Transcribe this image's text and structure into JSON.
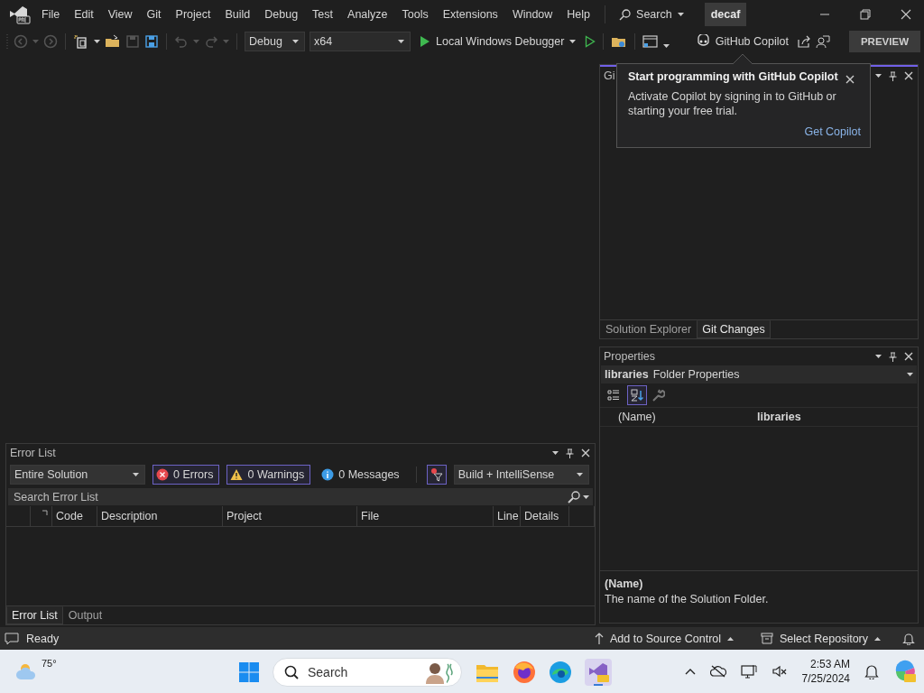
{
  "menu": [
    "File",
    "Edit",
    "View",
    "Git",
    "Project",
    "Build",
    "Debug",
    "Test",
    "Analyze",
    "Tools",
    "Extensions",
    "Window",
    "Help"
  ],
  "search_button": {
    "label": "Search"
  },
  "solution_name": "decaf",
  "toolbar": {
    "configuration": "Debug",
    "platform": "x64",
    "debugger": "Local Windows Debugger",
    "copilot": "GitHub Copilot",
    "preview": "PREVIEW"
  },
  "copilot_popup": {
    "title": "Start programming with GitHub Copilot",
    "body": "Activate Copilot by signing in to GitHub or starting your free trial.",
    "link": "Get Copilot"
  },
  "git_panel": {
    "title": "Gi",
    "tabs": [
      {
        "label": "Solution Explorer",
        "selected": false
      },
      {
        "label": "Git Changes",
        "selected": true
      }
    ]
  },
  "properties": {
    "title": "Properties",
    "object_name": "libraries",
    "object_type": "Folder Properties",
    "sort_modes": [
      {
        "kind": "categorized",
        "selected": false
      },
      {
        "kind": "alphabetical",
        "selected": true
      }
    ],
    "rows": [
      {
        "name": "(Name)",
        "value": "libraries"
      }
    ],
    "description": {
      "title": "(Name)",
      "text": "The name of the Solution Folder."
    }
  },
  "error_list": {
    "title": "Error List",
    "scope": "Entire Solution",
    "filters": [
      {
        "kind": "error",
        "label": "0 Errors",
        "selected": true
      },
      {
        "kind": "warning",
        "label": "0 Warnings",
        "selected": true
      },
      {
        "kind": "message",
        "label": "0 Messages",
        "selected": false
      }
    ],
    "source": "Build + IntelliSense",
    "search_placeholder": "Search Error List",
    "columns": [
      "Code",
      "Description",
      "Project",
      "File",
      "Line",
      "Details"
    ],
    "tabs": [
      {
        "label": "Error List",
        "selected": true
      },
      {
        "label": "Output",
        "selected": false
      }
    ]
  },
  "status_bar": {
    "status": "Ready",
    "source_control": "Add to Source Control",
    "repository": "Select Repository"
  },
  "taskbar": {
    "weather": "75°",
    "search_placeholder": "Search",
    "time": "2:53 AM",
    "date": "7/25/2024"
  }
}
